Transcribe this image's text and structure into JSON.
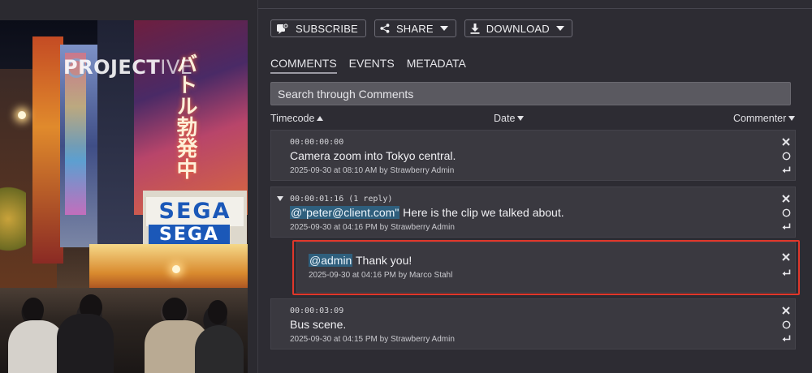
{
  "video": {
    "logo_text_bold": "PROJECT",
    "logo_text_light": "IVE",
    "signs": {
      "primary": "SEGA",
      "secondary": "SEGA",
      "kanji": "バトル勃発中"
    }
  },
  "toolbar": {
    "subscribe_label": "SUBSCRIBE",
    "share_label": "SHARE",
    "download_label": "DOWNLOAD"
  },
  "tabs": [
    {
      "label": "COMMENTS",
      "active": true
    },
    {
      "label": "EVENTS",
      "active": false
    },
    {
      "label": "METADATA",
      "active": false
    }
  ],
  "search": {
    "placeholder": "Search through Comments"
  },
  "columns": {
    "timecode": "Timecode",
    "date": "Date",
    "commenter": "Commenter"
  },
  "comments": [
    {
      "timecode": "00:00:00:00",
      "text": "Camera zoom into Tokyo central.",
      "meta": "2025-09-30 at 08:10 AM by Strawberry Admin"
    },
    {
      "timecode": "00:00:01:16 (1 reply)",
      "mention": "@\"peter@client.com\"",
      "text": " Here is the clip we talked about.",
      "meta": "2025-09-30 at 04:16 PM by Strawberry Admin",
      "reply": {
        "mention": "@admin",
        "text": " Thank you!",
        "meta": "2025-09-30 at 04:16 PM by Marco Stahl"
      }
    },
    {
      "timecode": "00:00:03:09",
      "text": "Bus scene.",
      "meta": "2025-09-30 at 04:15 PM by Strawberry Admin"
    }
  ],
  "colors": {
    "panel_bg": "#2d2c33",
    "card_bg": "#3a3940",
    "mention_bg": "#2f5f7d",
    "highlight_border": "#e0372a"
  }
}
